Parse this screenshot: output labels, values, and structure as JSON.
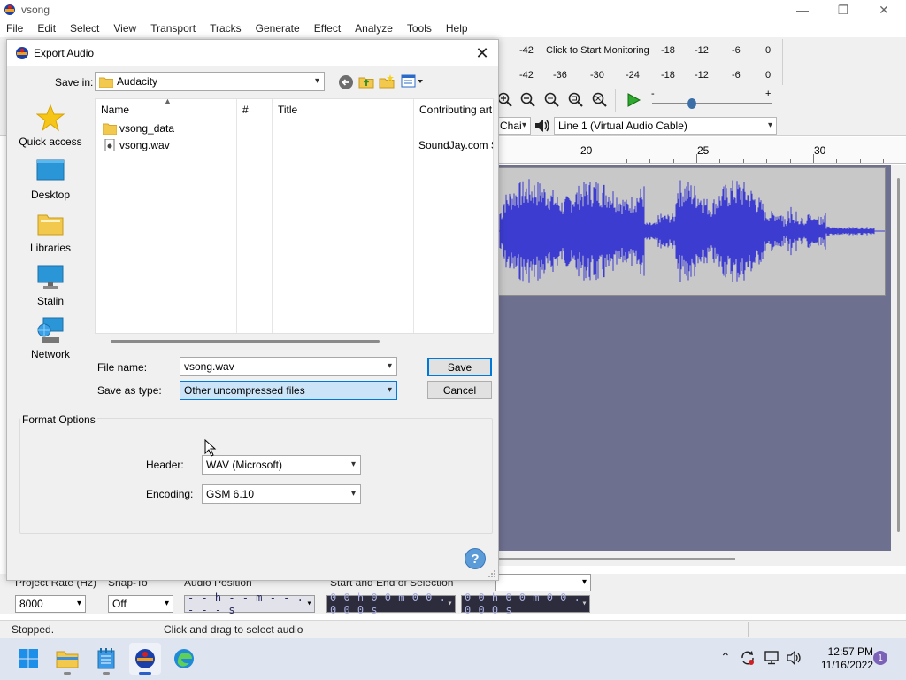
{
  "window": {
    "title": "vsong",
    "controls": {
      "minimize": "—",
      "maximize": "❐",
      "close": "✕"
    }
  },
  "menu": [
    "File",
    "Edit",
    "Select",
    "View",
    "Transport",
    "Tracks",
    "Generate",
    "Effect",
    "Analyze",
    "Tools",
    "Help"
  ],
  "meters": {
    "record": [
      "-42",
      "Click to Start Monitoring",
      "-18",
      "-12",
      "-6",
      "0"
    ],
    "playback": [
      "-42",
      "-36",
      "-30",
      "-24",
      "-18",
      "-12",
      "-6",
      "0"
    ]
  },
  "playback_slider": {
    "min": "-",
    "max": "+",
    "level": 0.3
  },
  "devices": {
    "channels_partial": "Chai",
    "output": "Line 1 (Virtual Audio Cable)"
  },
  "ruler": {
    "labels": [
      "20",
      "25",
      "30"
    ]
  },
  "selection_toolbar": {
    "project_rate_label": "Project Rate (Hz)",
    "project_rate_value": "8000",
    "snap_label": "Snap-To",
    "snap_value": "Off",
    "audio_position_label": "Audio Position",
    "audio_position_value": "- - h - - m - - . - - - s",
    "selection_label": "Start and End of Selection",
    "selection_start": "0 0 h 0 0 m 0 0 . 0 0 0 s",
    "selection_end": "0 0 h 0 0 m 0 0 . 0 0 0 s"
  },
  "status": {
    "state": "Stopped.",
    "hint": "Click and drag to select audio"
  },
  "dialog": {
    "title": "Export Audio",
    "save_in_label": "Save in:",
    "save_in_value": "Audacity",
    "places": [
      {
        "label": "Quick access",
        "icon": "star-icon"
      },
      {
        "label": "Desktop",
        "icon": "desktop-icon"
      },
      {
        "label": "Libraries",
        "icon": "libraries-icon"
      },
      {
        "label": "Stalin",
        "icon": "computer-icon"
      },
      {
        "label": "Network",
        "icon": "network-icon"
      }
    ],
    "columns": [
      "Name",
      "#",
      "Title",
      "Contributing art"
    ],
    "files": [
      {
        "name": "vsong_data",
        "type": "folder",
        "artist": ""
      },
      {
        "name": "vsong.wav",
        "type": "audio",
        "artist": "SoundJay.com S"
      }
    ],
    "file_name_label": "File name:",
    "file_name_value": "vsong.wav",
    "save_type_label": "Save as type:",
    "save_type_value": "Other uncompressed files",
    "save_button": "Save",
    "cancel_button": "Cancel",
    "format_options_label": "Format Options",
    "header_label": "Header:",
    "header_value": "WAV (Microsoft)",
    "encoding_label": "Encoding:",
    "encoding_value": "GSM 6.10",
    "help_glyph": "?"
  },
  "taskbar": {
    "time": "12:57 PM",
    "date": "11/16/2022",
    "notification_count": "1"
  },
  "colors": {
    "waveform": "#3c3cd0",
    "track_bg": "#6e7090",
    "clip_bg": "#c8c8c8",
    "accent": "#0078d7"
  }
}
